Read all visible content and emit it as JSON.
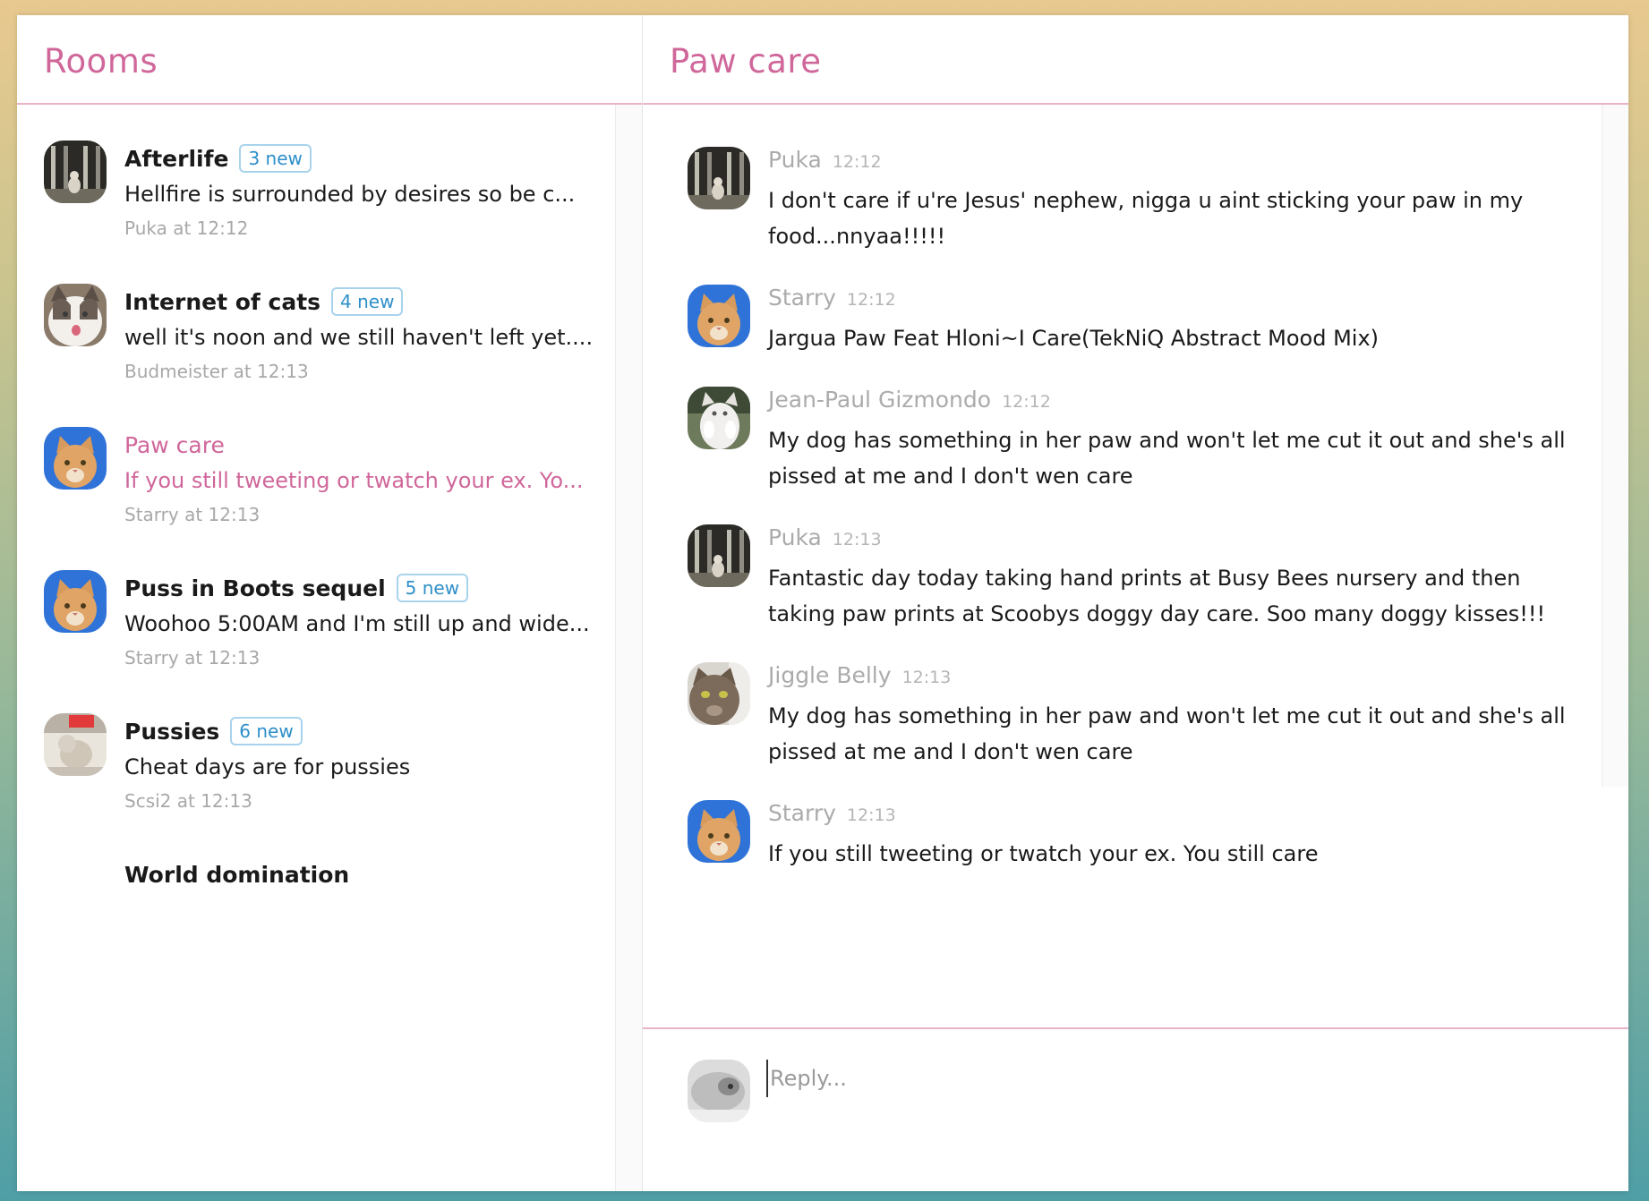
{
  "rooms_panel": {
    "title": "Rooms",
    "rooms": [
      {
        "name": "Afterlife",
        "badge": "3 new",
        "preview": "Hellfire is surrounded by desires so be c...",
        "meta": "Puka at 12:12",
        "avatar": "cat-in-window-avatar"
      },
      {
        "name": "Internet of cats",
        "badge": "4 new",
        "preview": "well it's noon and we still haven't left yet....",
        "meta": "Budmeister at 12:13",
        "avatar": "white-cat-avatar"
      },
      {
        "name": "Paw care",
        "badge": "",
        "preview": "If you still tweeting or twatch your ex. Yo...",
        "meta": "Starry at 12:13",
        "avatar": "orange-cat-blue-avatar",
        "active": true
      },
      {
        "name": "Puss in Boots sequel",
        "badge": "5 new",
        "preview": "Woohoo 5:00AM and I'm still up and wide...",
        "meta": "Starry at 12:13",
        "avatar": "orange-cat-blue-avatar"
      },
      {
        "name": "Pussies",
        "badge": "6 new",
        "preview": "Cheat days are for pussies",
        "meta": "Scsi2 at 12:13",
        "avatar": "grey-cat-red-avatar"
      },
      {
        "name": "World domination",
        "badge": "",
        "preview": "",
        "meta": "",
        "avatar": ""
      }
    ]
  },
  "chat_panel": {
    "title": "Paw care",
    "messages": [
      {
        "author": "Puka",
        "time": "12:12",
        "text": "I don't care if u're Jesus' nephew, nigga u aint sticking your paw in my food...nnyaa!!!!!",
        "avatar": "cat-in-window-avatar"
      },
      {
        "author": "Starry",
        "time": "12:12",
        "text": "Jargua Paw Feat Hloni~I Care(TekNiQ Abstract Mood Mix)",
        "avatar": "orange-cat-blue-avatar"
      },
      {
        "author": "Jean-Paul Gizmondo",
        "time": "12:12",
        "text": "My dog has something in her paw and won't let me cut it out and she's all pissed at me and I don't wen care",
        "avatar": "white-cat-paws-avatar"
      },
      {
        "author": "Puka",
        "time": "12:13",
        "text": "Fantastic day today taking hand prints at Busy Bees nursery and then taking paw prints at Scoobys doggy day care. Soo many doggy kisses!!!",
        "avatar": "cat-in-window-avatar"
      },
      {
        "author": "Jiggle Belly",
        "time": "12:13",
        "text": "My dog has something in her paw and won't let me cut it out and she's all pissed at me and I don't wen care",
        "avatar": "grumpy-cat-avatar"
      },
      {
        "author": "Starry",
        "time": "12:13",
        "text": "If you still tweeting or twatch your ex. You still care",
        "avatar": "orange-cat-blue-avatar"
      }
    ],
    "reply": {
      "placeholder": "Reply...",
      "value": "",
      "avatar": "current-user-cat-avatar"
    }
  },
  "colors": {
    "accent": "#d0679a",
    "badge": "#2e8fc9",
    "divider": "#ecb3c6"
  }
}
